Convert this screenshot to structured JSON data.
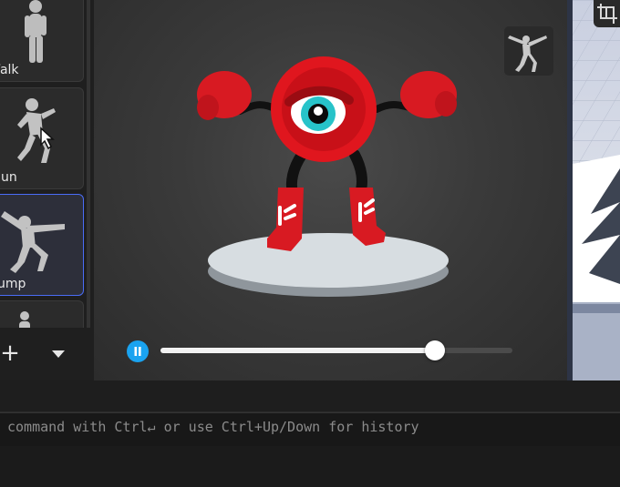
{
  "animations": [
    {
      "label": "Walk",
      "selected": false
    },
    {
      "label": "Run",
      "selected": false
    },
    {
      "label": "Jump",
      "selected": true
    },
    {
      "label": "",
      "selected": false
    }
  ],
  "animation_label_visible": [
    "Walk",
    "un",
    "ump"
  ],
  "toolbar": {
    "add_glyph": "+",
    "dropdown_icon": "chevron-down-icon"
  },
  "playback": {
    "state": "playing",
    "progress": 0.78
  },
  "console": {
    "hint": "command with Ctrl↵ or use Ctrl+Up/Down for history"
  },
  "colors": {
    "accent": "#1aa3f0",
    "selection": "#4a6cf7",
    "character": "#e0161e"
  }
}
